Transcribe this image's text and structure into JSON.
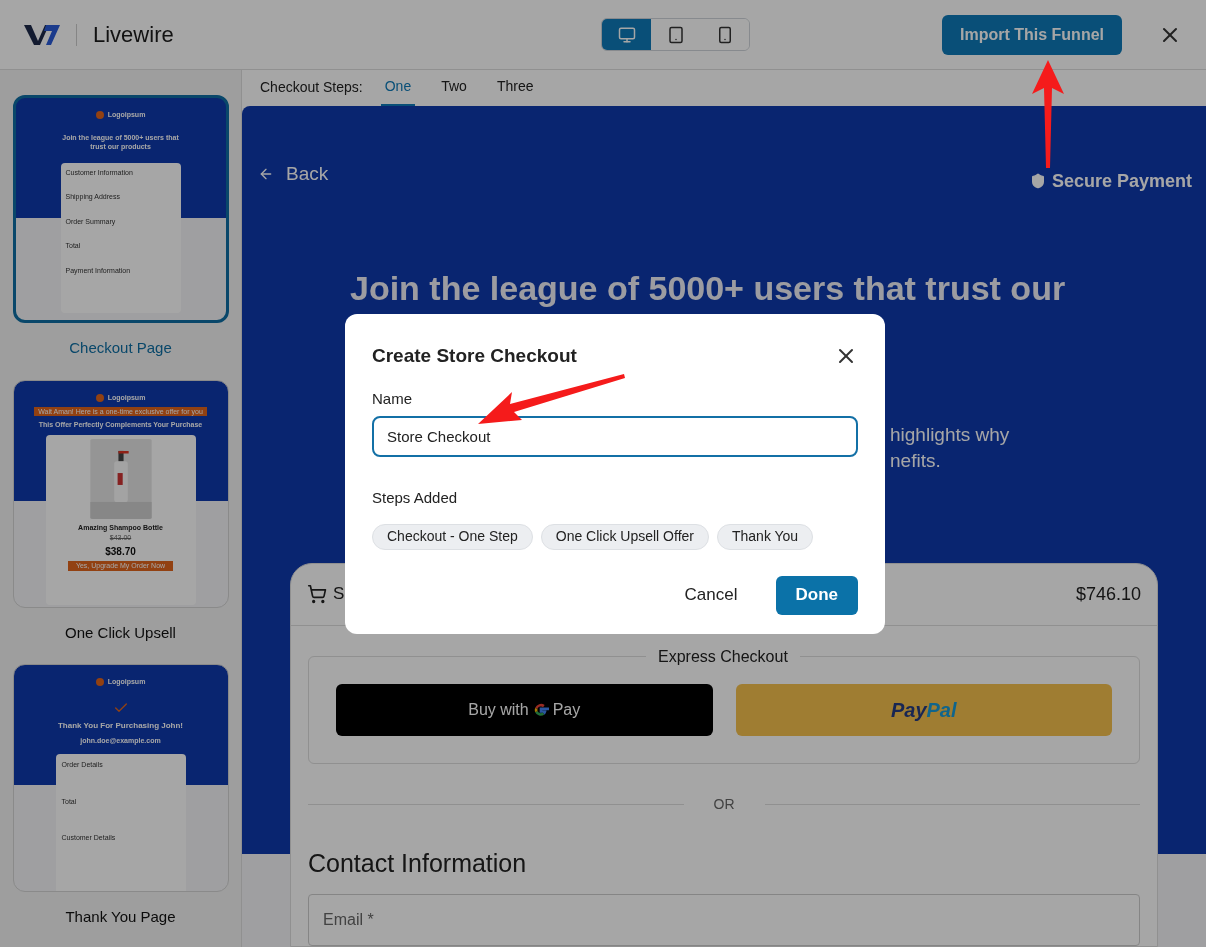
{
  "app": {
    "title": "Livewire"
  },
  "devices": [
    {
      "kind": "desktop",
      "selected": true
    },
    {
      "kind": "tablet",
      "selected": false
    },
    {
      "kind": "mobile",
      "selected": false
    }
  ],
  "import_button": "Import This Funnel",
  "templates": [
    {
      "kind": "checkout",
      "label": "Checkout Page",
      "selected": true,
      "logo": "Logoipsum",
      "heading": "Join the league of 5000+ users that trust our products",
      "sections": [
        "Customer Information",
        "Shipping Address",
        "Order Summary",
        "Total",
        "Payment Information"
      ]
    },
    {
      "kind": "upsell",
      "label": "One Click Upsell",
      "selected": false,
      "logo": "Logoipsum",
      "badge": "Wait Aman! Here is a one-time exclusive offer for you",
      "heading": "This Offer Perfectly Complements Your Purchase",
      "product": "Amazing Shampoo Bottle",
      "old_price": "$43.00",
      "price": "$38.70",
      "cta": "Yes, Upgrade My Order Now"
    },
    {
      "kind": "thankyou",
      "label": "Thank You Page",
      "selected": false,
      "logo": "Logoipsum",
      "heading": "Thank You For Purchasing John!",
      "email": "john.doe@example.com",
      "sections": [
        "Order Details",
        "Total",
        "Customer Details"
      ]
    }
  ],
  "steps_bar": {
    "label": "Checkout Steps:",
    "tabs": [
      {
        "label": "One",
        "selected": true
      },
      {
        "label": "Two",
        "selected": false
      },
      {
        "label": "Three",
        "selected": false
      }
    ]
  },
  "preview": {
    "back": "Back",
    "secure": "Secure Payment",
    "heading": "Join the league of 5000+ users that trust our",
    "text_fragments": [
      "highlights why",
      "nefits."
    ],
    "cart": {
      "title_fragment": "S",
      "total": "$746.10"
    },
    "express": "Express Checkout",
    "gpay": [
      "Buy with",
      "Pay"
    ],
    "paypal": [
      "Pay",
      "Pal"
    ],
    "or": "OR",
    "contact": "Contact Information",
    "email_placeholder": "Email *"
  },
  "dialog": {
    "title": "Create Store Checkout",
    "name_label": "Name",
    "name_value": "Store Checkout",
    "steps_label": "Steps Added",
    "steps": [
      "Checkout - One Step",
      "One Click Upsell Offer",
      "Thank You"
    ],
    "cancel": "Cancel",
    "done": "Done"
  }
}
